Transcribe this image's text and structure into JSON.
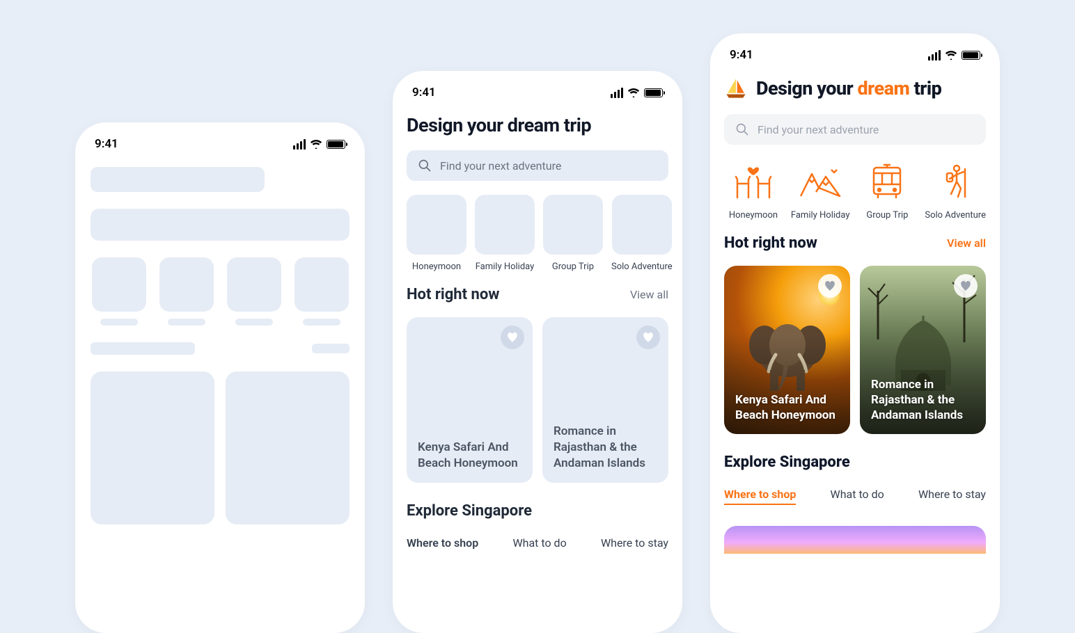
{
  "status": {
    "time": "9:41"
  },
  "accent": "#f97316",
  "heading": {
    "prefix": "Design your ",
    "accent": "dream",
    "suffix": " trip",
    "full": "Design your dream trip"
  },
  "search": {
    "placeholder": "Find your next adventure"
  },
  "categories": [
    {
      "key": "honeymoon",
      "label": "Honeymoon",
      "icon": "chairs-heart-icon"
    },
    {
      "key": "family",
      "label": "Family Holiday",
      "icon": "mountains-icon"
    },
    {
      "key": "group",
      "label": "Group Trip",
      "icon": "bus-icon"
    },
    {
      "key": "solo",
      "label": "Solo Adventure",
      "icon": "hiker-icon"
    }
  ],
  "hot": {
    "title": "Hot right now",
    "view_all": "View all",
    "cards": [
      {
        "title": "Kenya Safari And Beach Honeymoon"
      },
      {
        "title": "Romance in Rajasthan & the Andaman Islands"
      }
    ]
  },
  "explore": {
    "title": "Explore Singapore",
    "tabs": [
      {
        "label": "Where to shop",
        "active": true
      },
      {
        "label": "What to do",
        "active": false
      },
      {
        "label": "Where to stay",
        "active": false
      }
    ]
  }
}
